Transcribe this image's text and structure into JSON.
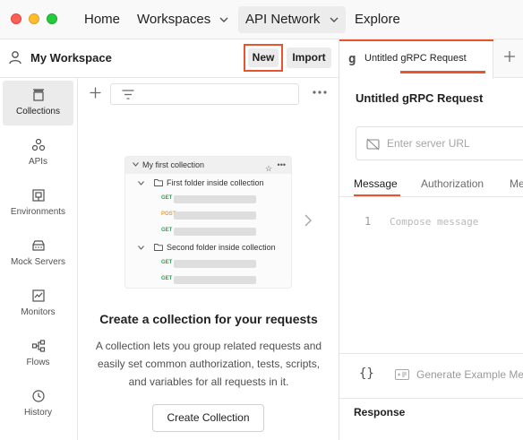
{
  "topnav": {
    "home": "Home",
    "workspaces": "Workspaces",
    "api_network": "API Network",
    "explore": "Explore"
  },
  "workspace": {
    "title": "My Workspace",
    "new_label": "New",
    "import_label": "Import"
  },
  "sidebar": {
    "items": [
      {
        "label": "Collections",
        "icon": "collections-icon",
        "active": true
      },
      {
        "label": "APIs",
        "icon": "apis-icon"
      },
      {
        "label": "Environments",
        "icon": "environments-icon"
      },
      {
        "label": "Mock Servers",
        "icon": "mock-servers-icon"
      },
      {
        "label": "Monitors",
        "icon": "monitors-icon"
      },
      {
        "label": "Flows",
        "icon": "flows-icon"
      },
      {
        "label": "History",
        "icon": "history-icon"
      }
    ]
  },
  "collections_panel": {
    "illustration": {
      "collection_name": "My first collection",
      "folders": [
        {
          "name": "First folder inside collection",
          "requests": [
            "GET",
            "POST",
            "GET"
          ]
        },
        {
          "name": "Second folder inside collection",
          "requests": [
            "GET",
            "GET"
          ]
        }
      ]
    },
    "empty_title": "Create a collection for your requests",
    "empty_description": "A collection lets you group related requests and easily set common authorization, tests, scripts, and variables for all requests in it.",
    "create_button": "Create Collection"
  },
  "request_tab": {
    "tab_label": "Untitled gRPC Request",
    "tab_icon_glyph": "g",
    "request_title": "Untitled gRPC Request",
    "url_placeholder": "Enter server URL",
    "sub_tabs": [
      "Message",
      "Authorization",
      "Me"
    ],
    "editor": {
      "line_number": "1",
      "placeholder": "Compose message"
    },
    "braces": "{}",
    "generate_label": "Generate Example Me",
    "response_title": "Response"
  },
  "colors": {
    "accent": "#e8542e",
    "get_method": "#1ea84a",
    "post_method": "#e9a03b"
  }
}
